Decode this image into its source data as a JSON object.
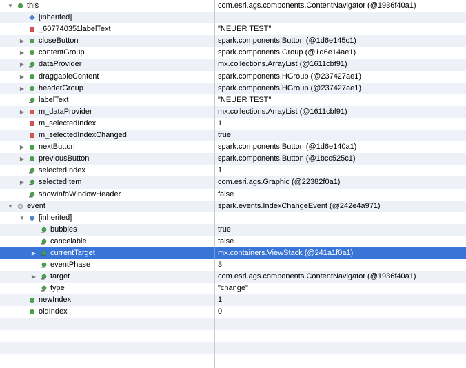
{
  "rows": [
    {
      "name": "this",
      "value": "com.esri.ags.components.ContentNavigator (@1936f40a1)",
      "icon": "green-circle-icon",
      "disclosure": "expanded",
      "indent": 0
    },
    {
      "name": "[inherited]",
      "value": "",
      "icon": "blue-diamond-icon",
      "disclosure": "none",
      "indent": 1
    },
    {
      "name": "_607740351labelText",
      "value": "\"NEUER TEST\"",
      "icon": "red-square-icon",
      "disclosure": "none",
      "indent": 1
    },
    {
      "name": "closeButton",
      "value": "spark.components.Button (@1d6e145c1)",
      "icon": "green-circle-icon",
      "disclosure": "collapsed",
      "indent": 1
    },
    {
      "name": "contentGroup",
      "value": "spark.components.Group (@1d6e14ae1)",
      "icon": "green-circle-icon",
      "disclosure": "collapsed",
      "indent": 1
    },
    {
      "name": "dataProvider",
      "value": "mx.collections.ArrayList (@1611cbf91)",
      "icon": "getter-icon",
      "disclosure": "collapsed",
      "indent": 1
    },
    {
      "name": "draggableContent",
      "value": "spark.components.HGroup (@237427ae1)",
      "icon": "green-circle-icon",
      "disclosure": "collapsed",
      "indent": 1
    },
    {
      "name": "headerGroup",
      "value": "spark.components.HGroup (@237427ae1)",
      "icon": "green-circle-icon",
      "disclosure": "collapsed",
      "indent": 1
    },
    {
      "name": "labelText",
      "value": "\"NEUER TEST\"",
      "icon": "getter-icon",
      "disclosure": "none",
      "indent": 1
    },
    {
      "name": "m_dataProvider",
      "value": "mx.collections.ArrayList (@1611cbf91)",
      "icon": "red-square-icon",
      "disclosure": "collapsed",
      "indent": 1
    },
    {
      "name": "m_selectedIndex",
      "value": "1",
      "icon": "red-square-icon",
      "disclosure": "none",
      "indent": 1
    },
    {
      "name": "m_selectedIndexChanged",
      "value": "true",
      "icon": "red-square-icon",
      "disclosure": "none",
      "indent": 1
    },
    {
      "name": "nextButton",
      "value": "spark.components.Button (@1d6e140a1)",
      "icon": "green-circle-icon",
      "disclosure": "collapsed",
      "indent": 1
    },
    {
      "name": "previousButton",
      "value": "spark.components.Button (@1bcc525c1)",
      "icon": "green-circle-icon",
      "disclosure": "collapsed",
      "indent": 1
    },
    {
      "name": "selectedIndex",
      "value": "1",
      "icon": "getter-icon",
      "disclosure": "none",
      "indent": 1
    },
    {
      "name": "selectedItem",
      "value": "com.esri.ags.Graphic (@22382f0a1)",
      "icon": "getter-icon",
      "disclosure": "collapsed",
      "indent": 1
    },
    {
      "name": "showInfoWindowHeader",
      "value": "false",
      "icon": "getter-icon",
      "disclosure": "none",
      "indent": 1
    },
    {
      "name": "event",
      "value": "spark.events.IndexChangeEvent (@242e4a971)",
      "icon": "local-variable-icon",
      "disclosure": "expanded",
      "indent": 0
    },
    {
      "name": "[inherited]",
      "value": "",
      "icon": "blue-diamond-icon",
      "disclosure": "expanded",
      "indent": 1
    },
    {
      "name": "bubbles",
      "value": "true",
      "icon": "getter-icon",
      "disclosure": "none",
      "indent": 2
    },
    {
      "name": "cancelable",
      "value": "false",
      "icon": "getter-icon",
      "disclosure": "none",
      "indent": 2
    },
    {
      "name": "currentTarget",
      "value": "mx.containers.ViewStack (@241a1f0a1)",
      "icon": "getter-icon",
      "disclosure": "collapsed",
      "indent": 2,
      "selected": true
    },
    {
      "name": "eventPhase",
      "value": "3",
      "icon": "getter-icon",
      "disclosure": "none",
      "indent": 2
    },
    {
      "name": "target",
      "value": "com.esri.ags.components.ContentNavigator (@1936f40a1)",
      "icon": "getter-icon",
      "disclosure": "collapsed",
      "indent": 2
    },
    {
      "name": "type",
      "value": "\"change\"",
      "icon": "getter-icon",
      "disclosure": "none",
      "indent": 2
    },
    {
      "name": "newIndex",
      "value": "1",
      "icon": "green-circle-icon",
      "disclosure": "none",
      "indent": 1
    },
    {
      "name": "oldIndex",
      "value": "0",
      "icon": "green-circle-icon",
      "disclosure": "none",
      "indent": 1
    },
    {
      "name": "",
      "value": "",
      "icon": "",
      "disclosure": "none",
      "indent": 0
    },
    {
      "name": "",
      "value": "",
      "icon": "",
      "disclosure": "none",
      "indent": 0
    },
    {
      "name": "",
      "value": "",
      "icon": "",
      "disclosure": "none",
      "indent": 0
    },
    {
      "name": "",
      "value": "",
      "icon": "",
      "disclosure": "none",
      "indent": 0
    }
  ],
  "colors": {
    "selection": "#3875d7",
    "stripe": "#eef2f8",
    "public": "#47a447",
    "private": "#d9534f",
    "inherited": "#4a8ad9"
  }
}
